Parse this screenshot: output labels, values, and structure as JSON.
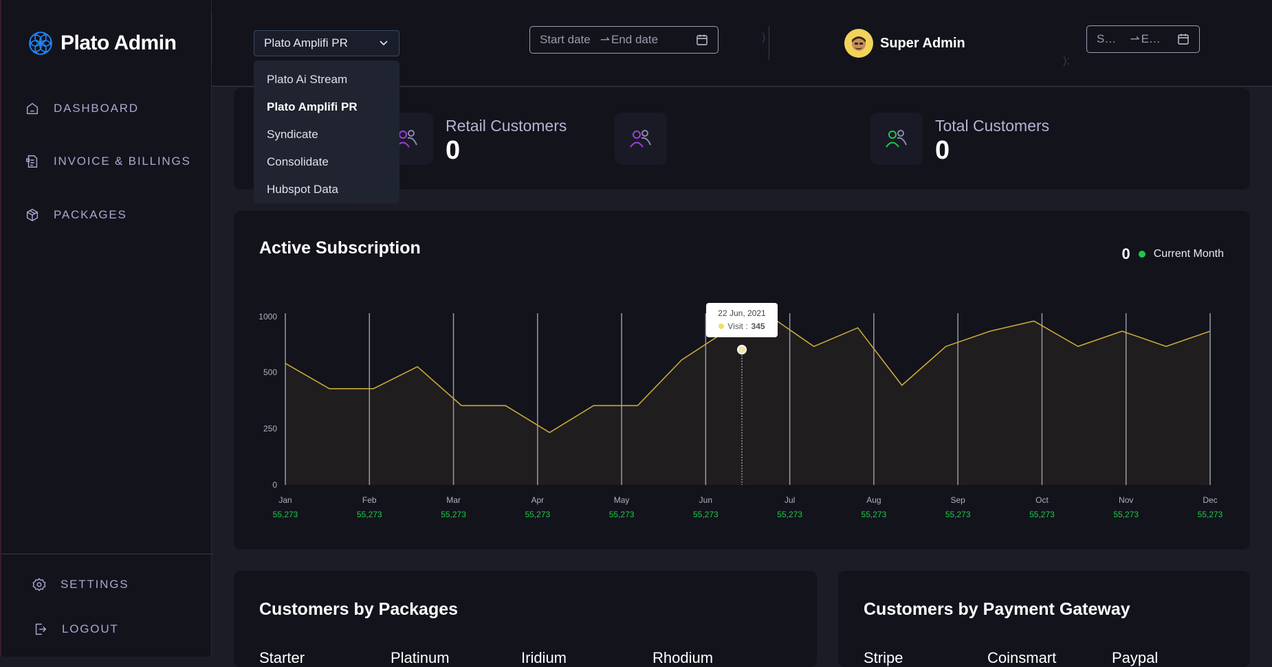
{
  "brand": {
    "name": "Plato Admin",
    "icon": "flower-logo-icon",
    "accent": "#1e88ff"
  },
  "sidebar": {
    "items": [
      {
        "label": "DASHBOARD",
        "icon": "home-icon"
      },
      {
        "label": "INVOICE & BILLINGS",
        "icon": "invoice-icon"
      },
      {
        "label": "PACKAGES",
        "icon": "package-icon"
      }
    ],
    "bottom": [
      {
        "label": "SETTINGS",
        "icon": "gear-icon"
      },
      {
        "label": "LOGOUT",
        "icon": "logout-icon"
      }
    ]
  },
  "header": {
    "select_value": "Plato Amplifi PR",
    "date_range_1": {
      "start": "Start date",
      "end": "End date"
    },
    "date_range_2": {
      "start": "S…",
      "end": "E…"
    },
    "faint_text_1": ")",
    "faint_text_2": ");",
    "user_name": "Super Admin"
  },
  "dropdown": {
    "options": [
      "Plato Ai Stream",
      "Plato Amplifi PR",
      "Syndicate",
      "Consolidate",
      "Hubspot Data"
    ],
    "selected": "Plato Amplifi PR"
  },
  "stats": {
    "retail": {
      "label": "Retail Customers",
      "value": "0"
    },
    "total": {
      "label": "Total Customers",
      "value": "0"
    }
  },
  "subscription": {
    "title": "Active Subscription",
    "legend_count": "0",
    "legend_label": "Current Month",
    "legend_color": "#1ec94a"
  },
  "chart_data": {
    "type": "area",
    "title": "Active Subscription",
    "line_color": "#c9a93a",
    "y_ticks": [
      "1000",
      "500",
      "250",
      "0"
    ],
    "months": [
      "Jan",
      "Feb",
      "Mar",
      "Apr",
      "May",
      "Jun",
      "Jul",
      "Aug",
      "Sep",
      "Oct",
      "Nov",
      "Dec"
    ],
    "month_values": [
      "55,273",
      "55,273",
      "55,273",
      "55,273",
      "55,273",
      "55,273",
      "55,273",
      "55,273",
      "55,273",
      "55,273",
      "55,273",
      "55,273"
    ],
    "series": [
      {
        "values": [
          720,
          570,
          570,
          700,
          470,
          470,
          310,
          470,
          470,
          740,
          910,
          1000,
          820,
          930,
          590,
          820,
          910,
          970,
          820,
          910,
          820,
          910
        ]
      }
    ],
    "tooltip": {
      "date": "22 Jun, 2021",
      "label": "Visit :",
      "value": "345"
    }
  },
  "packages_card": {
    "title": "Customers by Packages",
    "columns": [
      "Starter",
      "Platinum",
      "Iridium",
      "Rhodium"
    ]
  },
  "gateway_card": {
    "title": "Customers by Payment Gateway",
    "columns": [
      "Stripe",
      "Coinsmart",
      "Paypal"
    ]
  }
}
